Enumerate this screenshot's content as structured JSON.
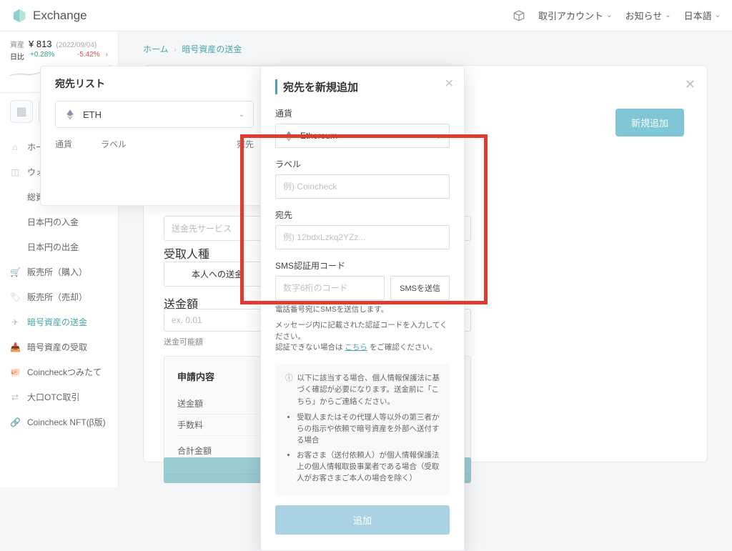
{
  "header": {
    "brand": "Exchange",
    "right": {
      "account": "取引アカウント",
      "notice": "お知らせ",
      "lang": "日本語"
    }
  },
  "sidebar_top": {
    "asset_label": "資産",
    "asset_value": "¥ 813",
    "date": "(2022/09/04)",
    "dod_label": "日比",
    "change_up": "+0.28%",
    "change_down": "-5.42%"
  },
  "sidebar_nav": [
    "ホーム",
    "ウォレット",
    "総資産",
    "日本円の入金",
    "日本円の出金",
    "販売所（購入）",
    "販売所（売却）",
    "暗号資産の送金",
    "暗号資産の受取",
    "Coincheckつみたて",
    "大口OTC取引",
    "Coincheck NFT(β版)"
  ],
  "breadcrumbs": {
    "home": "ホーム",
    "current": "暗号資産の送金"
  },
  "card": {
    "add_button": "新規追加"
  },
  "side_panel": {
    "title": "宛先リスト",
    "currency": "ETH",
    "cols": {
      "currency": "通貨",
      "label": "ラベル",
      "addr": "宛先"
    }
  },
  "bg_form": {
    "service_ph": "送金先サービス",
    "recipient_label": "受取人種別",
    "recipient_value": "本人への送金",
    "amount_label": "送金額",
    "amount_ph": "ex. 0.01",
    "balance_label": "送金可能額",
    "confirm_title": "申請内容",
    "rows": [
      "送金額",
      "手数料",
      "合計金額"
    ]
  },
  "modal": {
    "title": "宛先を新規追加",
    "currency_label": "通貨",
    "currency_value": "Ethereum",
    "label_label": "ラベル",
    "label_ph": "例) Coincheck",
    "addr_label": "宛先",
    "addr_ph": "例) 12bdxLzkq2YZz...",
    "sms_label": "SMS認証用コード",
    "sms_ph": "数字6桁のコード",
    "sms_btn": "SMSを送信",
    "sms_hint1": "電話番号宛にSMSを送信します。",
    "sms_hint2a": "メッセージ内に記載された認証コードを入力してください。",
    "sms_hint2b_pre": "認証できない場合は ",
    "sms_hint2b_link": "こちら",
    "sms_hint2b_post": " をご確認ください。",
    "notice_head_pre": "以下に該当する場合、個人情報保護法に基づく確認が必要になります。送金前に「",
    "notice_head_link": "こちら",
    "notice_head_post": "」からご連絡ください。",
    "notice_li1": "受取人またはその代理人等以外の第三者からの指示や依頼で暗号資産を外部へ送付する場合",
    "notice_li2": "お客さま（送付依頼人）が個人情報保護法上の個人情報取扱事業者である場合（受取人がお客さまご本人の場合を除く）",
    "submit": "追加"
  }
}
